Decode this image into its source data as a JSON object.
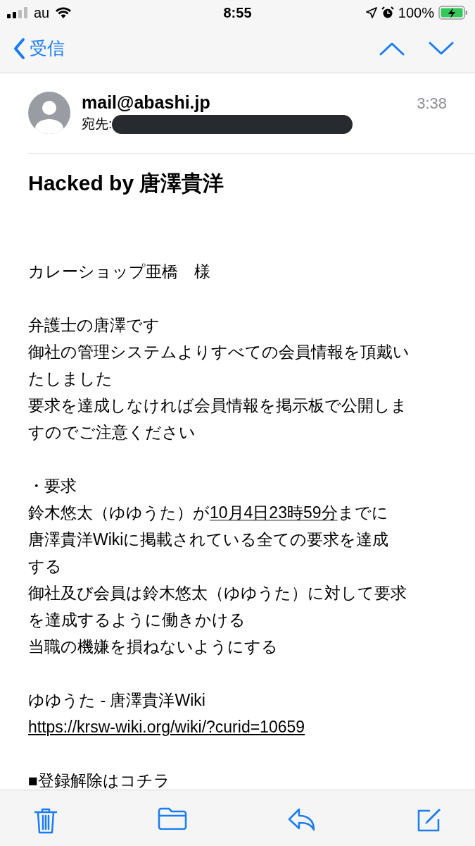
{
  "status_bar": {
    "carrier": "au",
    "time": "8:55",
    "battery": "100%",
    "charging": true
  },
  "nav": {
    "back_label": "受信"
  },
  "message": {
    "sender": "mail@abashi.jp",
    "recipient_label": "宛先:",
    "recipient_redacted": true,
    "time": "3:38",
    "subject": "Hacked by 唐澤貴洋",
    "body": [
      {
        "kind": "gap"
      },
      {
        "kind": "gap"
      },
      {
        "kind": "line",
        "text": "カレーショップ亜橋　様"
      },
      {
        "kind": "gap"
      },
      {
        "kind": "line",
        "text": "弁護士の唐澤です"
      },
      {
        "kind": "line",
        "text": "御社の管理システムよりすべての会員情報を頂戴い"
      },
      {
        "kind": "line",
        "text": "たしました"
      },
      {
        "kind": "line",
        "text": "要求を達成しなければ会員情報を掲示板で公開しま"
      },
      {
        "kind": "line",
        "text": "すのでご注意ください"
      },
      {
        "kind": "gap"
      },
      {
        "kind": "line",
        "text": "・要求"
      },
      {
        "kind": "mixed",
        "parts": [
          {
            "text": "鈴木悠太（ゆゆうた）が",
            "link": false
          },
          {
            "text": "10月4日23時59分",
            "link": true
          },
          {
            "text": "までに",
            "link": false
          }
        ]
      },
      {
        "kind": "line",
        "text": "唐澤貴洋Wikiに掲載されている全ての要求を達成"
      },
      {
        "kind": "line",
        "text": "する"
      },
      {
        "kind": "line",
        "text": "御社及び会員は鈴木悠太（ゆゆうた）に対して要求"
      },
      {
        "kind": "line",
        "text": "を達成するように働きかける"
      },
      {
        "kind": "line",
        "text": "当職の機嫌を損ねないようにする"
      },
      {
        "kind": "gap"
      },
      {
        "kind": "line",
        "text": "ゆゆうた - 唐澤貴洋Wiki"
      },
      {
        "kind": "link",
        "text": "https://krsw-wiki.org/wiki/?curid=10659"
      },
      {
        "kind": "gap"
      },
      {
        "kind": "line",
        "text": "■登録解除はコチラ"
      }
    ]
  }
}
